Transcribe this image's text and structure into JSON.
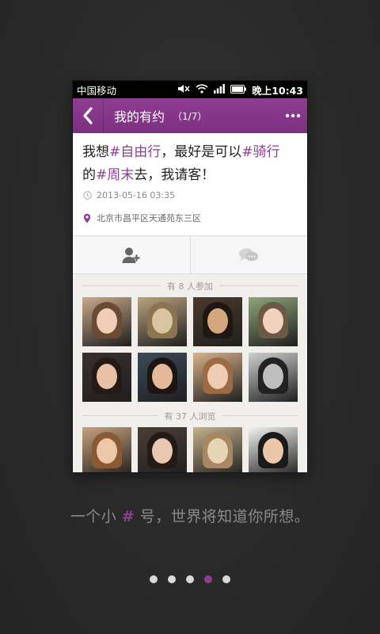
{
  "status_bar": {
    "carrier": "中国移动",
    "time": "晚上10:43"
  },
  "header": {
    "title": "我的有约",
    "count": "（1/7）"
  },
  "post": {
    "segments": [
      {
        "text": "我想",
        "tag": false
      },
      {
        "text": "#自由行",
        "tag": true
      },
      {
        "text": "，最好是可以",
        "tag": false
      },
      {
        "text": "#骑行",
        "tag": true
      },
      {
        "text": "的",
        "tag": false
      },
      {
        "text": "#周末",
        "tag": true
      },
      {
        "text": "去，我请客！",
        "tag": false
      }
    ],
    "datetime": "2013-05-16  03:35",
    "location": "北京市昌平区天通苑东三区"
  },
  "participants_label": "有 8 人参加",
  "viewers_label": "有 37 人浏览",
  "participants": [
    {
      "icon": "avatar-photo",
      "bg": "#c9a98a",
      "skin": "#f1cdb6",
      "hair": "#6b4a34"
    },
    {
      "icon": "cat-photo",
      "bg": "#b9a37e",
      "skin": "#d8c4a0",
      "hair": "#8c7352"
    },
    {
      "icon": "avatar-photo",
      "bg": "#4a3a2a",
      "skin": "#d5a77f",
      "hair": "#1e1712"
    },
    {
      "icon": "avatar-photo",
      "bg": "#8fa57a",
      "skin": "#f0d2bd",
      "hair": "#6a5a44"
    },
    {
      "icon": "avatar-photo",
      "bg": "#3a302c",
      "skin": "#e8c0a4",
      "hair": "#241b17"
    },
    {
      "icon": "avatar-photo",
      "bg": "#3b4a5a",
      "skin": "#e3b99a",
      "hair": "#1b1614"
    },
    {
      "icon": "avatar-photo",
      "bg": "#d8b28a",
      "skin": "#f0cdb0",
      "hair": "#9c6b44"
    },
    {
      "icon": "camera-photo",
      "bg": "#d0d0d0",
      "skin": "#bfbfbf",
      "hair": "#222222"
    }
  ],
  "viewers": [
    {
      "icon": "avatar-photo",
      "bg": "#c9a27e",
      "skin": "#ecc7a8",
      "hair": "#8a5a34"
    },
    {
      "icon": "avatar-photo",
      "bg": "#4a3f38",
      "skin": "#eac7b0",
      "hair": "#241a16"
    },
    {
      "icon": "hamster-photo",
      "bg": "#c4b08c",
      "skin": "#e6d5b5",
      "hair": "#a88862"
    },
    {
      "icon": "avatar-photo",
      "bg": "#f2f2f0",
      "skin": "#ecc6a8",
      "hair": "#1a1a1a"
    }
  ],
  "caption": {
    "before": "一个小 ",
    "hash": "#",
    "after": " 号，世界将知道你所想。"
  },
  "pager": {
    "count": 5,
    "active": 3
  },
  "colors": {
    "accent": "#8e3e92",
    "background": "#2b2b2b"
  }
}
